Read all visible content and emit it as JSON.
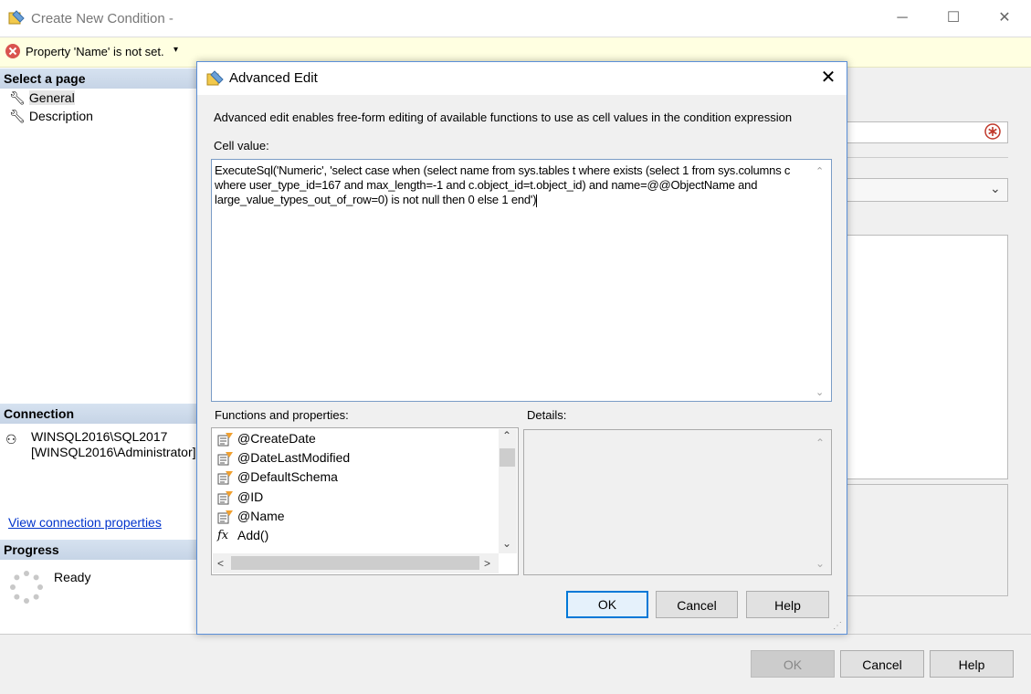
{
  "window": {
    "title": "Create New Condition -",
    "minimize": "─",
    "maximize": "☐",
    "close": "✕"
  },
  "warning": {
    "text": "Property 'Name' is not set.",
    "caret": "▾"
  },
  "left_pane": {
    "select_page_header": "Select a page",
    "pages": [
      {
        "label": "General"
      },
      {
        "label": "Description"
      }
    ],
    "connection_header": "Connection",
    "connection_line1": "WINSQL2016\\SQL2017",
    "connection_line2": "[WINSQL2016\\Administrator]",
    "view_connection_link": "View connection properties",
    "progress_header": "Progress",
    "progress_status": "Ready"
  },
  "outer_buttons": {
    "ok": "OK",
    "cancel": "Cancel",
    "help": "Help"
  },
  "dialog": {
    "title": "Advanced Edit",
    "close": "✕",
    "description": "Advanced edit enables free-form editing of available functions to use as cell values in the condition expression",
    "cell_value_label": "Cell value:",
    "cell_value": "ExecuteSql('Numeric', 'select case when (select name from sys.tables t where  exists (select 1 from sys.columns c where user_type_id=167 and max_length=-1 and c.object_id=t.object_id) and name=@@ObjectName and large_value_types_out_of_row=0) is not null then 0 else 1 end')",
    "functions_label": "Functions and properties:",
    "details_label": "Details:",
    "functions": [
      {
        "label": "@CreateDate",
        "icon": "property-icon"
      },
      {
        "label": "@DateLastModified",
        "icon": "property-icon"
      },
      {
        "label": "@DefaultSchema",
        "icon": "property-icon"
      },
      {
        "label": "@ID",
        "icon": "property-icon"
      },
      {
        "label": "@Name",
        "icon": "property-icon"
      },
      {
        "label": "Add()",
        "icon": "function-icon"
      }
    ],
    "ok": "OK",
    "cancel": "Cancel",
    "help": "Help"
  },
  "colors": {
    "accent": "#0078d7",
    "warning_bg": "#ffffe1",
    "section_header": "#d6e2f0",
    "link": "#0033cc"
  }
}
